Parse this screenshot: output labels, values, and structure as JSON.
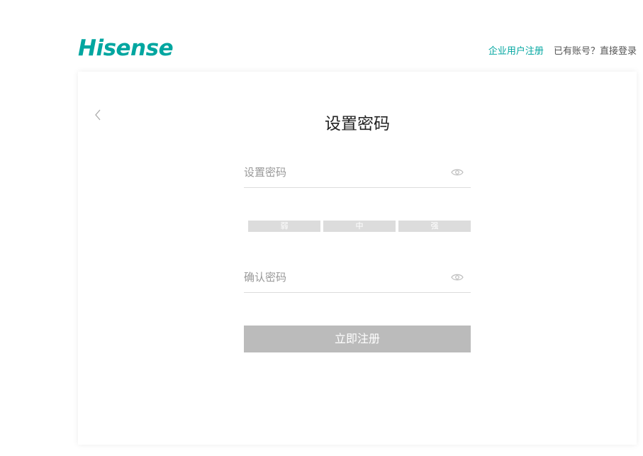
{
  "header": {
    "logo_text": "Hisense",
    "enterprise_register": "企业用户注册",
    "have_account": "已有账号？",
    "login": "直接登录"
  },
  "form": {
    "title": "设置密码",
    "password_placeholder": "设置密码",
    "confirm_placeholder": "确认密码",
    "strength_levels": [
      "弱",
      "中",
      "强"
    ],
    "submit_label": "立即注册"
  },
  "icons": {
    "back": "chevron-left-icon",
    "eye": "eye-icon"
  },
  "colors": {
    "brand": "#00a6a0",
    "button_disabled": "#bbbbbb",
    "strength_bar": "#dcdcdc"
  }
}
